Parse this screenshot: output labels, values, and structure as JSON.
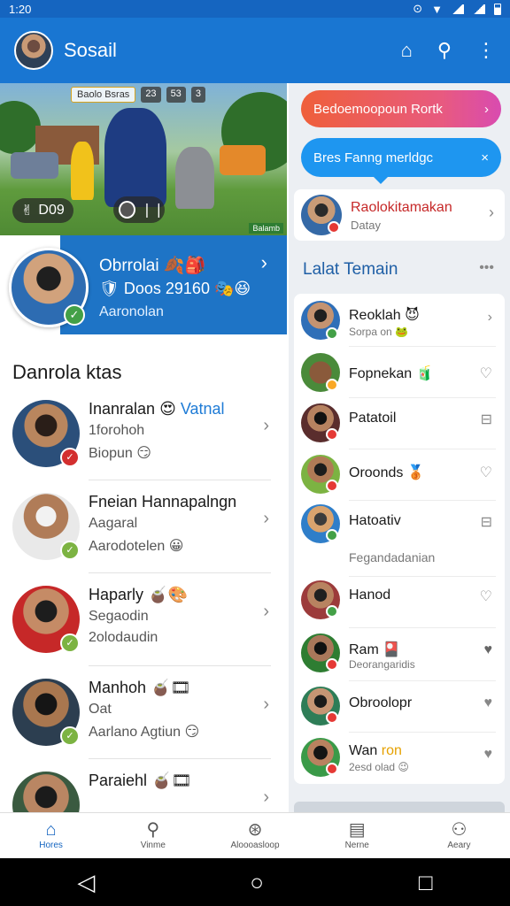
{
  "status_bar": {
    "time": "1:20"
  },
  "app_bar": {
    "title": "Sosail",
    "icons": [
      "bell-icon",
      "search-icon",
      "more-vert-icon"
    ]
  },
  "banner": {
    "chips": [
      "Baolo Bsras",
      "23",
      "53",
      "3"
    ],
    "counter_text": "D09",
    "watermark": "Balamb"
  },
  "profile": {
    "name": "Obrrolai",
    "number": "Doos 29160",
    "sub": "Aaronolan"
  },
  "friends_section": {
    "title": "Danrola ktas",
    "items": [
      {
        "line1": "Inanralan",
        "line1_accent": "Vatnal",
        "line2": "1forohoh",
        "line3": "Biopun",
        "line3_style": "red",
        "badge": "red"
      },
      {
        "line1": "Fneian Hannapalngn",
        "line1_accent": "",
        "line2": "Aagaral",
        "line3": "Aarodotelen",
        "line3_style": "",
        "badge": "green"
      },
      {
        "line1": "Haparly",
        "line1_accent": "",
        "line2": "Segaodin",
        "line3": "2olodaudin",
        "line3_style": "",
        "badge": "green"
      },
      {
        "line1": "Manhoh",
        "line1_accent": "",
        "line2": "Oat",
        "line3": "Aarlano Agtiun",
        "line3_style": "",
        "badge": "green"
      },
      {
        "line1": "Paraiehl",
        "line1_accent": "",
        "line2": "",
        "line3": "",
        "line3_style": "",
        "badge": "green"
      }
    ]
  },
  "right_panel": {
    "bubble1": "Bedoemoopoun Rortk",
    "bubble2": "Bres Fanng merldgc",
    "invite": {
      "title": "Raolokitamakan",
      "sub": "Datay"
    },
    "latest_title": "Lalat Temain",
    "latest": [
      {
        "name": "Reoklah",
        "sub": "Sorpa on",
        "action": "chevron",
        "badge": "green"
      },
      {
        "name": "Fopnekan",
        "sub": "",
        "action": "heart",
        "badge": "orange"
      },
      {
        "name": "Patatoil",
        "sub": "",
        "action": "lock",
        "badge": "red"
      },
      {
        "name": "Oroonds",
        "sub": "",
        "action": "heart",
        "badge": "red"
      },
      {
        "name": "Hatoativ",
        "sub": "Fegandadanian",
        "action": "lock",
        "badge": "green"
      },
      {
        "name": "Hanod",
        "sub": "",
        "action": "heart",
        "badge": "green"
      },
      {
        "name": "Ram",
        "sub": "Deorangaridis",
        "action": "heart-filled",
        "badge": "red"
      },
      {
        "name": "Obroolopr",
        "sub": "",
        "action": "heart-red",
        "badge": "red"
      },
      {
        "name": "Wan",
        "name_accent": "ron",
        "sub": "2esd olad",
        "action": "heart-red",
        "badge": "red"
      }
    ]
  },
  "bottom_nav": [
    {
      "label": "Hores",
      "icon": "home-icon",
      "active": true
    },
    {
      "label": "Vinme",
      "icon": "search-icon",
      "active": false
    },
    {
      "label": "Aloooasloop",
      "icon": "explore-icon",
      "active": false
    },
    {
      "label": "Nerne",
      "icon": "news-icon",
      "active": false
    },
    {
      "label": "Aeary",
      "icon": "person-icon",
      "active": false
    }
  ],
  "colors": {
    "primary": "#1976d2",
    "accent": "#1e7bd6",
    "online": "#43a047",
    "alert": "#e53935"
  }
}
